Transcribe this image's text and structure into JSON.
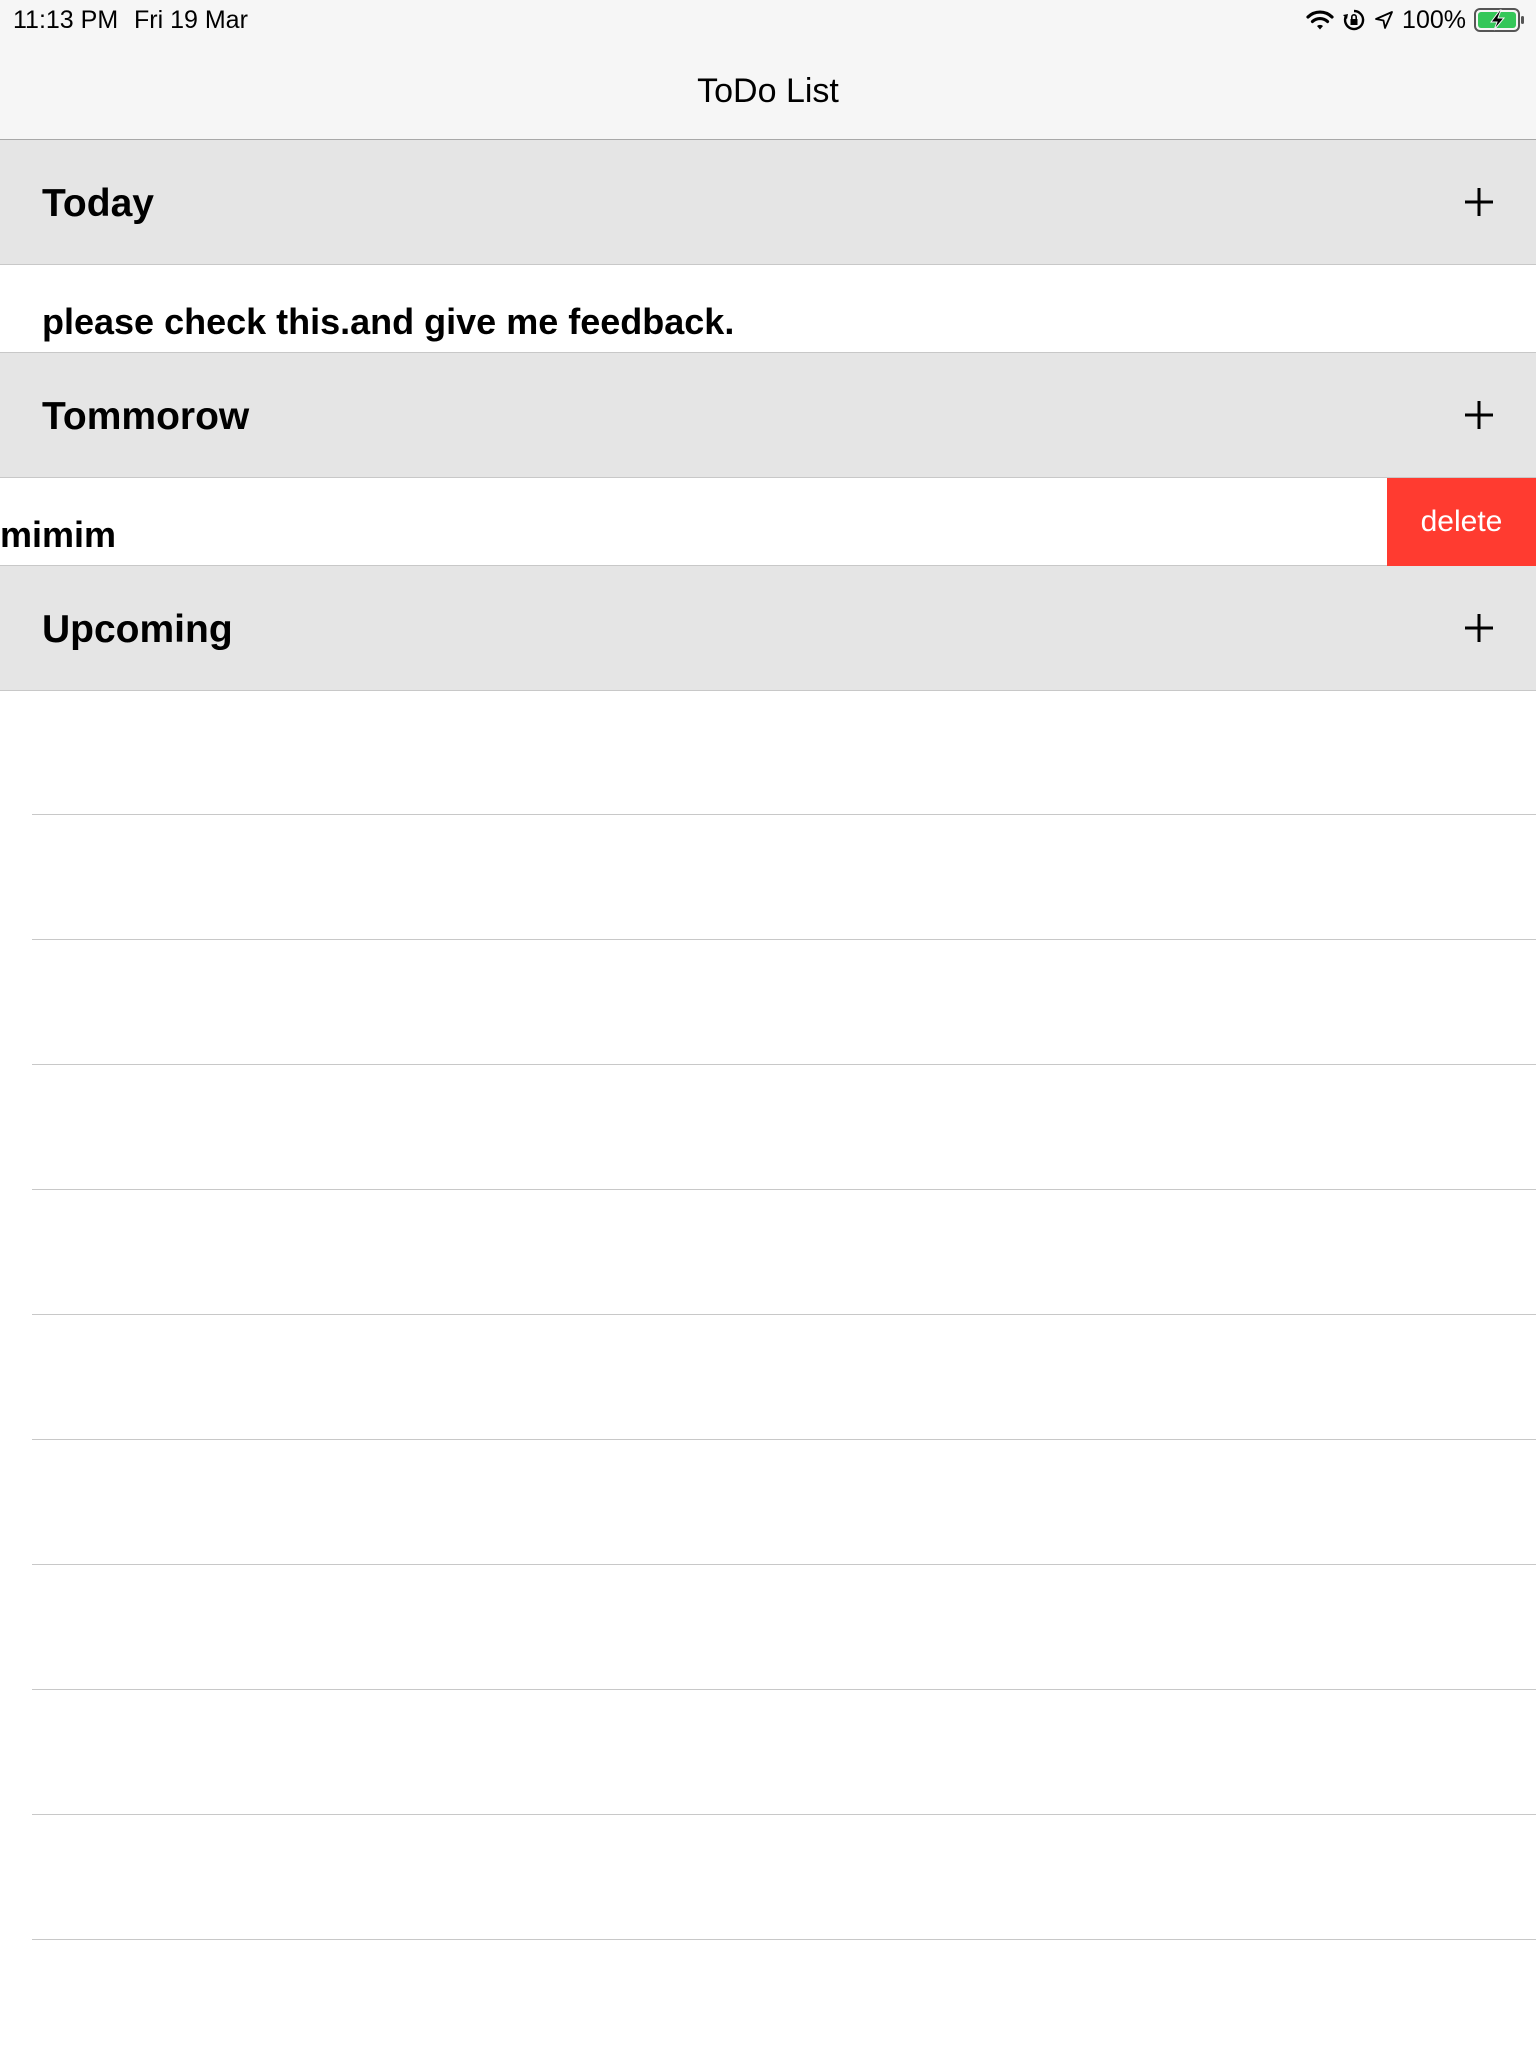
{
  "status_bar": {
    "time": "11:13 PM",
    "date": "Fri 19 Mar",
    "battery": "100%",
    "icons": [
      "wifi-icon",
      "rotation-lock-icon",
      "location-icon",
      "battery-charging-icon"
    ]
  },
  "nav": {
    "title": "ToDo List"
  },
  "sections": [
    {
      "title": "Today",
      "add_icon": "plus-icon",
      "items": [
        "please check this.and give me feedback."
      ]
    },
    {
      "title": "Tommorow",
      "add_icon": "plus-icon",
      "items": [
        "mimim"
      ],
      "swipe_action": "delete"
    },
    {
      "title": "Upcoming",
      "add_icon": "plus-icon",
      "items": []
    }
  ],
  "colors": {
    "header_bg": "#e5e5e5",
    "bar_bg": "#f6f6f6",
    "delete": "#ff3b30",
    "battery_fill": "#34c759"
  }
}
